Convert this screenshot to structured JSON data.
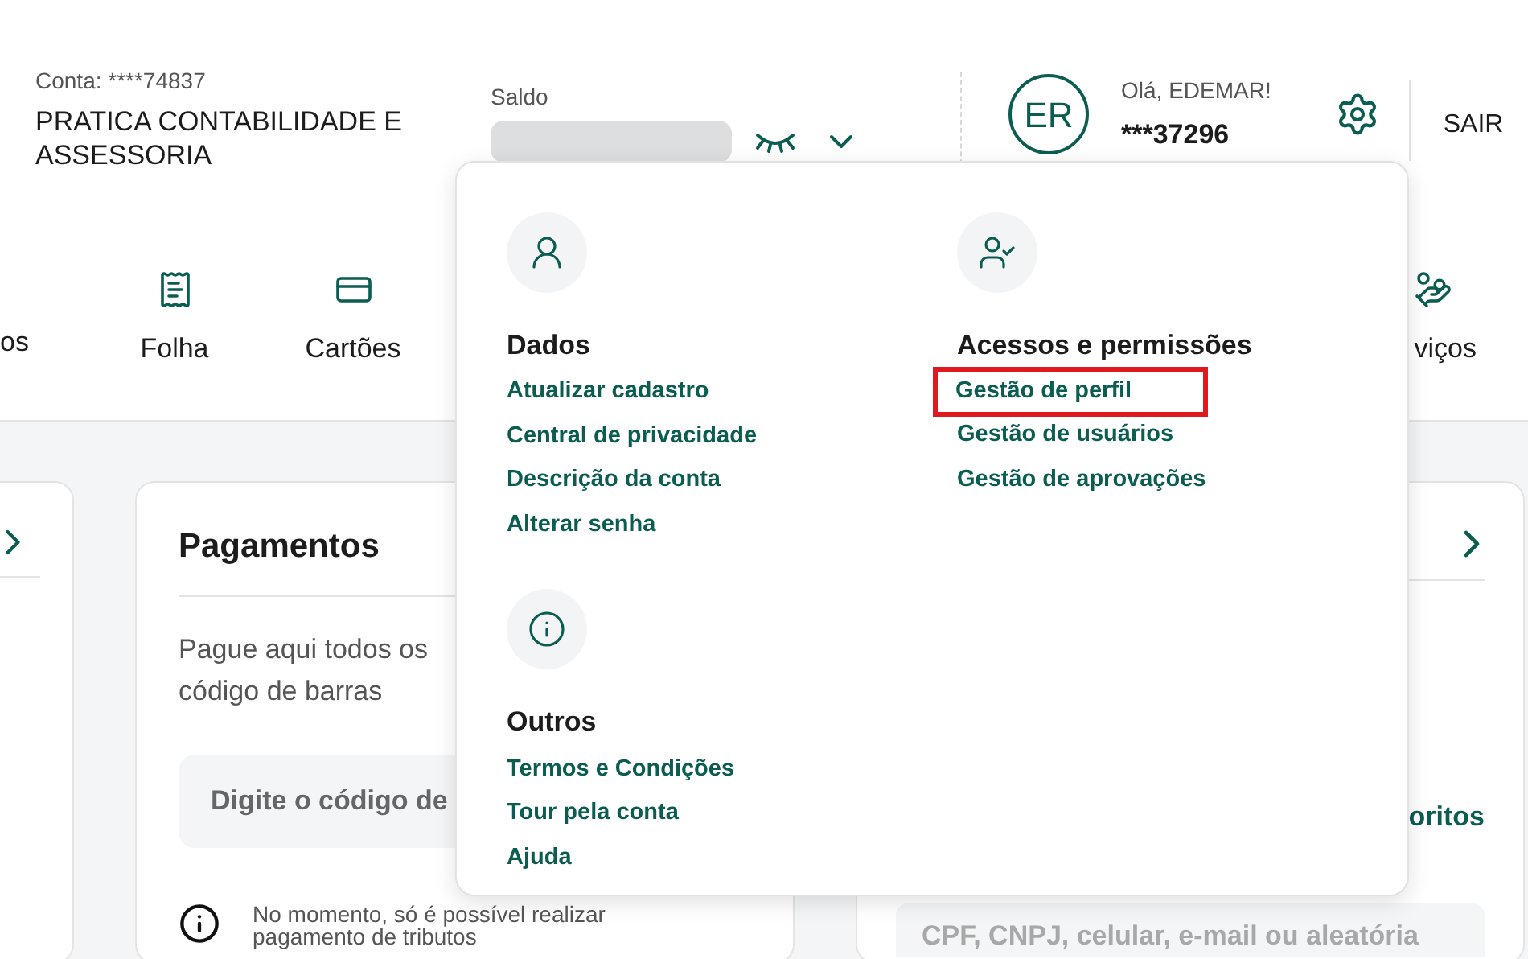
{
  "account": {
    "label": "Conta: ****74837",
    "company": "PRATICA CONTABILIDADE E ASSESSORIA"
  },
  "balance": {
    "label": "Saldo",
    "hidden": true
  },
  "user": {
    "initials": "ER",
    "greeting": "Olá, EDEMAR!",
    "id": "***37296"
  },
  "logout": "SAIR",
  "nav": [
    {
      "label": "os",
      "kind": "plain"
    },
    {
      "label": "Folha",
      "kind": "document"
    },
    {
      "label": "Cartões",
      "kind": "card"
    },
    {
      "label": "viços",
      "kind": "hand"
    }
  ],
  "payments_card": {
    "title": "Pagamentos",
    "text_lines": [
      "Pague aqui todos os",
      "código de barras"
    ],
    "placeholder": "Digite o código de",
    "notice_lines": [
      "No momento, só é possível realizar",
      "pagamento de tributos"
    ]
  },
  "pix_card": {
    "link": "oritos",
    "placeholder": "CPF, CNPJ, celular, e-mail ou aleatória"
  },
  "menu": {
    "columns": [
      [
        {
          "title": "Dados",
          "kind": "person",
          "links": [
            {
              "label": "Atualizar cadastro",
              "highlighted": false
            },
            {
              "label": "Central de privacidade",
              "highlighted": false
            },
            {
              "label": "Descrição da conta",
              "highlighted": false
            },
            {
              "label": "Alterar senha",
              "highlighted": false
            }
          ]
        },
        {
          "title": "Outros",
          "kind": "info",
          "links": [
            {
              "label": "Termos e Condições",
              "highlighted": false
            },
            {
              "label": "Tour pela conta",
              "highlighted": false
            },
            {
              "label": "Ajuda",
              "highlighted": false
            }
          ]
        }
      ],
      [
        {
          "title": "Acessos e permissões",
          "kind": "user-check",
          "links": [
            {
              "label": "Gestão de perfil",
              "highlighted": true
            },
            {
              "label": "Gestão de usuários",
              "highlighted": false
            },
            {
              "label": "Gestão de aprovações",
              "highlighted": false
            }
          ]
        }
      ]
    ]
  }
}
